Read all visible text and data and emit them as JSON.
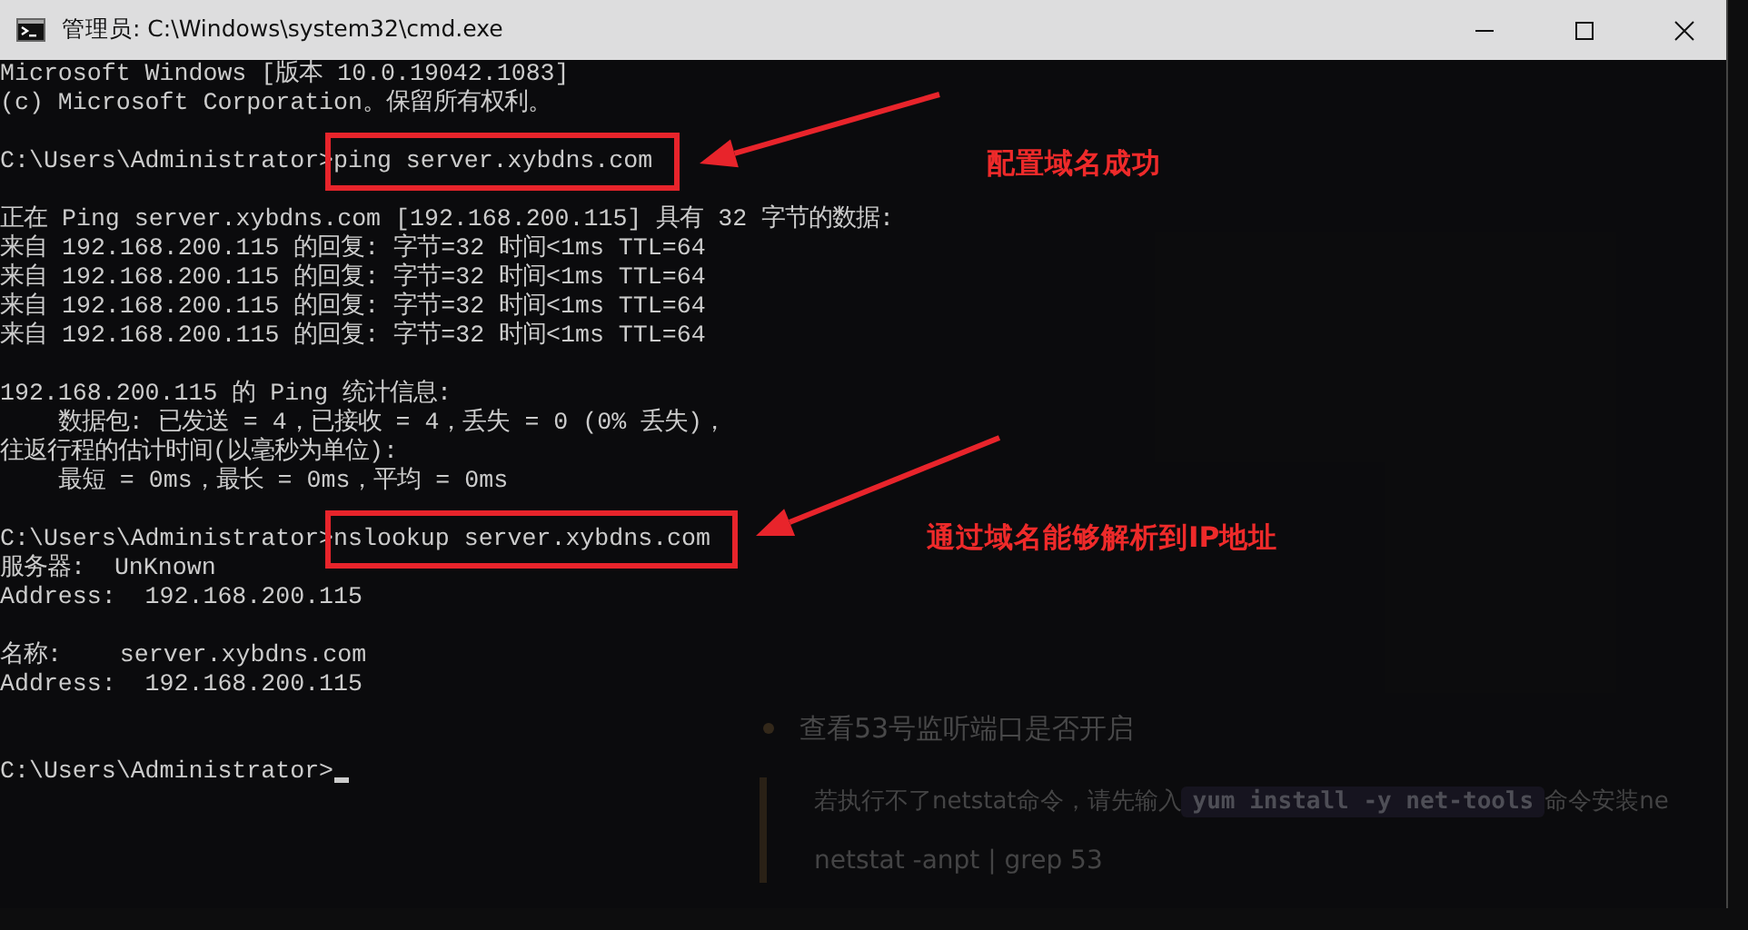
{
  "window": {
    "title": "管理员: C:\\Windows\\system32\\cmd.exe"
  },
  "console": {
    "lines": [
      {
        "kind": "text",
        "text": "Microsoft Windows [版本 10.0.19042.1083]"
      },
      {
        "kind": "text",
        "text": "(c) Microsoft Corporation。保留所有权利。"
      },
      {
        "kind": "blank"
      },
      {
        "kind": "prompt",
        "prompt": "C:\\Users\\Administrator>",
        "command": "ping server.xybdns.com",
        "boxed": true
      },
      {
        "kind": "blank"
      },
      {
        "kind": "text",
        "text": "正在 Ping server.xybdns.com [192.168.200.115] 具有 32 字节的数据:"
      },
      {
        "kind": "text",
        "text": "来自 192.168.200.115 的回复: 字节=32 时间<1ms TTL=64"
      },
      {
        "kind": "text",
        "text": "来自 192.168.200.115 的回复: 字节=32 时间<1ms TTL=64"
      },
      {
        "kind": "text",
        "text": "来自 192.168.200.115 的回复: 字节=32 时间<1ms TTL=64"
      },
      {
        "kind": "text",
        "text": "来自 192.168.200.115 的回复: 字节=32 时间<1ms TTL=64"
      },
      {
        "kind": "blank"
      },
      {
        "kind": "text",
        "text": "192.168.200.115 的 Ping 统计信息:"
      },
      {
        "kind": "text",
        "text": "    数据包: 已发送 = 4，已接收 = 4，丢失 = 0 (0% 丢失)，"
      },
      {
        "kind": "text",
        "text": "往返行程的估计时间(以毫秒为单位):"
      },
      {
        "kind": "text",
        "text": "    最短 = 0ms，最长 = 0ms，平均 = 0ms"
      },
      {
        "kind": "blank"
      },
      {
        "kind": "prompt",
        "prompt": "C:\\Users\\Administrator>",
        "command": "nslookup server.xybdns.com",
        "boxed": true
      },
      {
        "kind": "text",
        "text": "服务器:  UnKnown"
      },
      {
        "kind": "text",
        "text": "Address:  192.168.200.115"
      },
      {
        "kind": "blank"
      },
      {
        "kind": "text",
        "text": "名称:    server.xybdns.com"
      },
      {
        "kind": "text",
        "text": "Address:  192.168.200.115"
      },
      {
        "kind": "blank"
      },
      {
        "kind": "blank"
      },
      {
        "kind": "prompt",
        "prompt": "C:\\Users\\Administrator>",
        "cursor": true
      }
    ]
  },
  "annotations": [
    {
      "text": "配置域名成功"
    },
    {
      "text": "通过域名能够解析到IP地址"
    }
  ],
  "background_page": {
    "bullet": "查看53号监听端口是否开启",
    "note": {
      "before": "若执行不了netstat命令，请先输入",
      "code": "yum install -y net-tools",
      "after": "命令安装ne"
    },
    "command": "netstat -anpt | grep 53"
  }
}
